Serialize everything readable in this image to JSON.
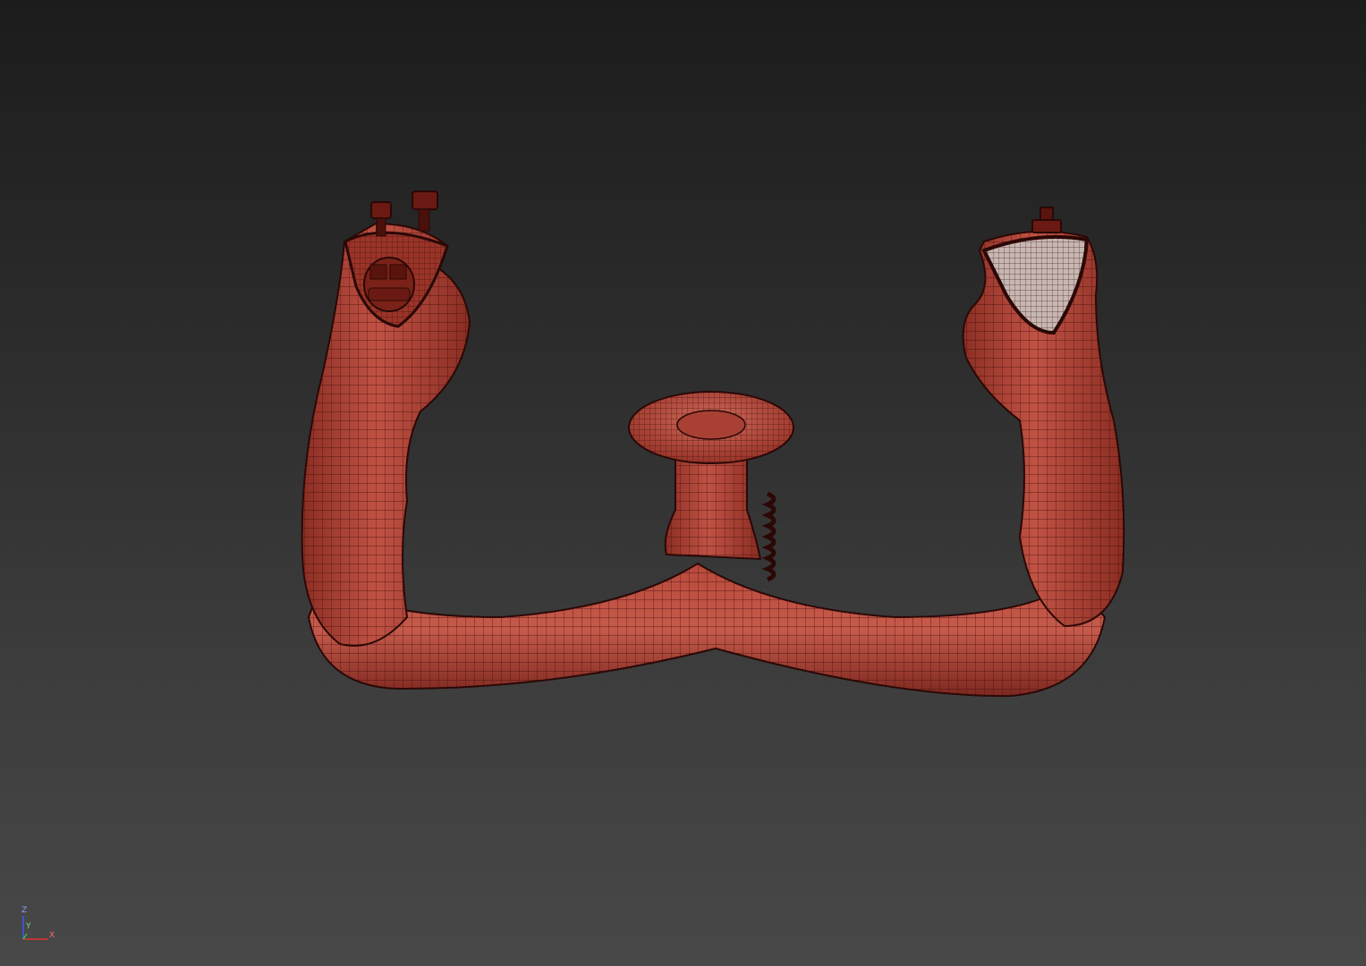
{
  "viewport": {
    "background_top": "#1c1c1c",
    "background_bottom": "#484848"
  },
  "model": {
    "name": "yoke",
    "shaded_color": "#a83c30",
    "highlight_color": "#d06a5c",
    "wire_color": "#3a0c08",
    "display_mode": "wireframe-on-shaded"
  },
  "axis_gizmo": {
    "z_label": "Z",
    "y_label": "Y",
    "x_label": "X",
    "z_color": "#3b56ff",
    "y_color": "#3fbf3f",
    "x_color": "#e03030"
  }
}
